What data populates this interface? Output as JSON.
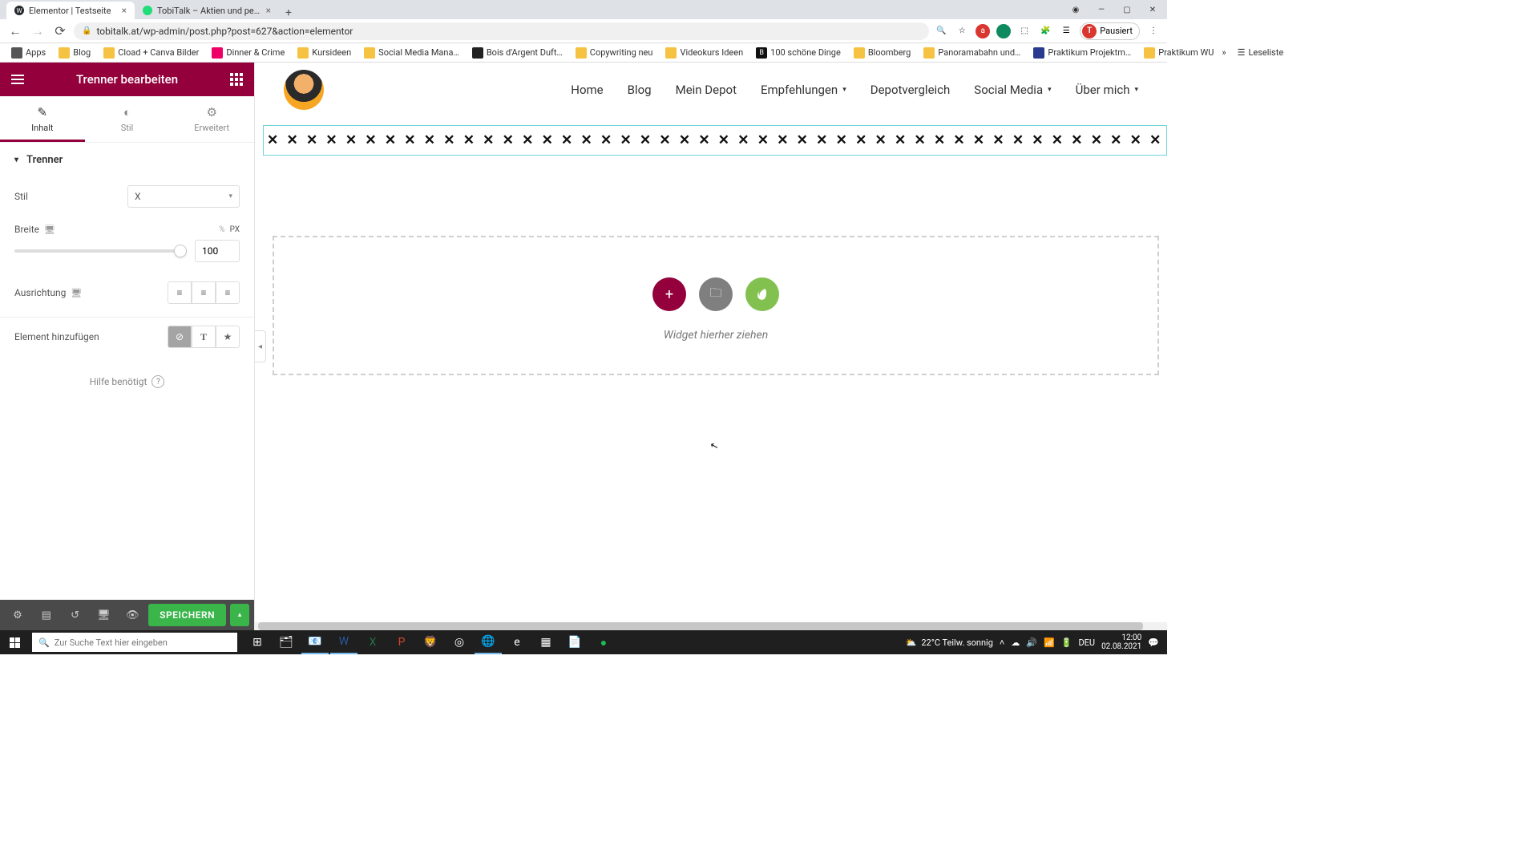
{
  "browser": {
    "tabs": [
      {
        "title": "Elementor | Testseite",
        "active": true
      },
      {
        "title": "TobiTalk – Aktien und persönliche…",
        "active": false
      }
    ],
    "url": "tobitalk.at/wp-admin/post.php?post=627&action=elementor",
    "profile_label": "Pausiert",
    "profile_initial": "T",
    "bookmarks": [
      "Apps",
      "Blog",
      "Cload + Canva Bilder",
      "Dinner & Crime",
      "Kursideen",
      "Social Media Mana…",
      "Bois d'Argent Duft…",
      "Copywriting neu",
      "Videokurs Ideen",
      "100 schöne Dinge",
      "Bloomberg",
      "Panoramabahn und…",
      "Praktikum Projektm…",
      "Praktikum WU"
    ],
    "reading_list": "Leseliste"
  },
  "sidebar": {
    "title": "Trenner bearbeiten",
    "tabs": {
      "content": "Inhalt",
      "style": "Stil",
      "advanced": "Erweitert"
    },
    "section_label": "Trenner",
    "style_label": "Stil",
    "style_value": "X",
    "width_label": "Breite",
    "width_units": {
      "pct": "%",
      "px": "PX"
    },
    "width_value": "100",
    "align_label": "Ausrichtung",
    "add_element_label": "Element hinzufügen",
    "help_label": "Hilfe benötigt",
    "footer": {
      "save": "SPEICHERN"
    }
  },
  "site": {
    "nav": [
      "Home",
      "Blog",
      "Mein Depot",
      "Empfehlungen",
      "Depotvergleich",
      "Social Media",
      "Über mich"
    ],
    "nav_dropdown_indices": [
      3,
      5,
      6
    ]
  },
  "canvas": {
    "divider_pattern": "✕ ✕ ✕ ✕ ✕ ✕ ✕ ✕ ✕ ✕ ✕ ✕ ✕ ✕ ✕ ✕ ✕ ✕ ✕ ✕ ✕ ✕ ✕ ✕ ✕ ✕ ✕ ✕ ✕ ✕ ✕ ✕ ✕ ✕ ✕ ✕ ✕ ✕ ✕ ✕ ✕ ✕ ✕ ✕ ✕ ✕ ✕ ✕ ✕ ✕ ✕ ✕ ✕ ✕ ✕ ✕ ✕ ✕ ✕ ✕ ✕",
    "drop_hint": "Widget hierher ziehen"
  },
  "taskbar": {
    "search_placeholder": "Zur Suche Text hier eingeben",
    "weather": "22°C  Teilw. sonnig",
    "lang": "DEU",
    "time": "12:00",
    "date": "02.08.2021"
  },
  "colors": {
    "brand": "#93003c",
    "save": "#39b54a",
    "envato": "#82c14f"
  }
}
